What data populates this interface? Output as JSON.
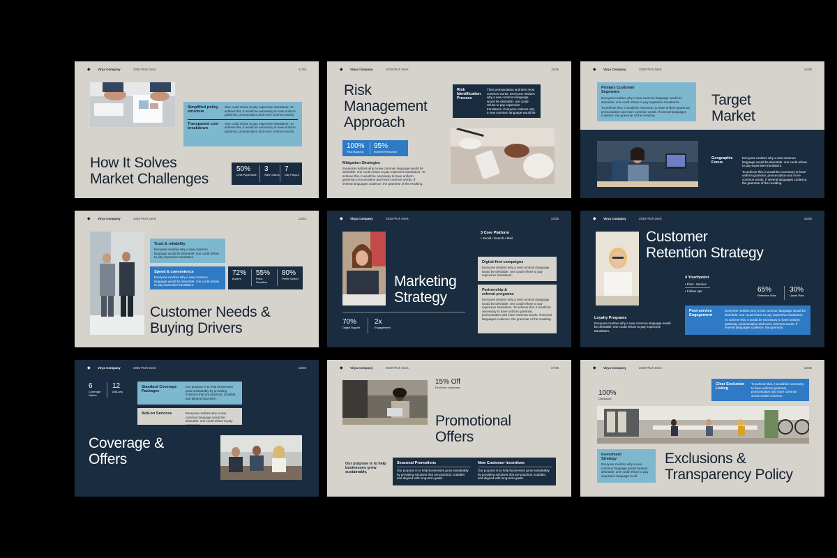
{
  "common": {
    "company": "Virya Company",
    "deck": "2030 Pitch Deck"
  },
  "s1": {
    "page": "11/35",
    "title_line1": "How It Solves",
    "title_line2": "Market Challenges",
    "row1_key": "Simplified policy structure",
    "row1_text": "One could refuse to pay expensive translators. To achieve this, it would be necessary to have uniform grammar, pronunciation and more common words.",
    "row2_key": "Transparent cost breakdown",
    "row2_text": "One could refuse to pay expensive translators. To achieve this, it would be necessary to have uniform grammar, pronunciation and more common words.",
    "stat1_num": "50%",
    "stat1_label": "Less Paperwork",
    "stat2_num": "3",
    "stat2_label": "Step Claims",
    "stat3_num": "7",
    "stat3_label": "Day Payout"
  },
  "s2": {
    "page": "11/35",
    "title_line1": "Risk",
    "title_line2": "Management",
    "title_line3": "Approach",
    "box_key": "Risk Identification Process",
    "box_text": "Their pronunciation and their most common words. Everyone realizes why a new common language would be desirable: one could refuse to pay expensive translators. Everyone realizes why a new common language would be.",
    "stat1_num": "100%",
    "stat1_label": "Risk Mapping",
    "stat2_num": "95%",
    "stat2_label": "Incident Reduction",
    "mit_title": "Mitigation Strategies",
    "mit_text": "Everyone realizes why a new common language would be desirable: one could refuse to pay expensive translators. To achieve this, it would be necessary to have uniform grammar, pronunciation and more common words. If several languages coalesce, the grammar of the resulting."
  },
  "s3": {
    "page": "12/35",
    "title_line1": "Target",
    "title_line2": "Market",
    "box_title": "Primary Customer Segments",
    "box_text1": "Everyone realizes why a new common language would be desirable: one could refuse to pay expensive translators.",
    "box_text2": "To achieve this, it would be necessary to have uniform grammar, pronunciation and more common words. If several languages coalesce, the grammar of the resulting.",
    "geo_key": "Geographic Focus",
    "geo_text1": "Everyone realizes why a new common language would be desirable: one could refuse to pay expensive translators.",
    "geo_text2": "To achieve this, it would be necessary to have uniform grammar, pronunciation and more common words. If several languages coalesce, the grammar of the resulting."
  },
  "s4": {
    "page": "13/35",
    "title_line1": "Customer Needs &",
    "title_line2": "Buying Drivers",
    "box1_title": "Trust & reliability",
    "box1_text": "Everyone realizes why a new common language would be desirable: one could refuse to pay expensive translators.",
    "box2_title": "Speed & convenience",
    "box2_text": "Everyone realizes why a new common language would be desirable: one could refuse to pay expensive translators.",
    "stat1_num": "72%",
    "stat1_label": "Buyers",
    "stat2_num": "55%",
    "stat2_label": "Price-Sensitive",
    "stat3_num": "80%",
    "stat3_label": "Prefer Speed"
  },
  "s5": {
    "page": "14/35",
    "title_line1": "Marketing",
    "title_line2": "Strategy",
    "platform_title": "3 Core Platform",
    "platform_text": "• Social • Search • Mail",
    "box1_title": "Digital-first campaigns",
    "box1_text": "Everyone realizes why a new common language would be desirable: one could refuse to pay expensive translators.",
    "box2_title": "Partnership & referral programs",
    "box2_text": "Everyone realizes why a new common language would be desirable: one could refuse to pay expensive translators. To achieve this, it would be necessary to have uniform grammar, pronunciation and more common words. If several languages coalesce, the grammar of the resulting.",
    "stat1_num": "70%",
    "stat1_label": "Digital Bugdet",
    "stat2_num": "2x",
    "stat2_label": "Engagement"
  },
  "s6": {
    "page": "15/35",
    "title_line1": "Customer",
    "title_line2": "Retention Strategy",
    "tp_title": "4 Youchpoint",
    "tp_item1": "• Post - Service",
    "tp_item2": "• Follow ups",
    "stat1_num": "65%",
    "stat1_label": "Retention Rate",
    "stat2_num": "30%",
    "stat2_label": "Upsell Rate",
    "loyal_title": "Loyalty Programs",
    "loyal_text": "Everyone realizes why a new common language would be desirable: one could refuse to pay expensive translators.",
    "box_key": "Post-service Engagement",
    "box_text1": "Everyone realizes why a new common language would be desirable: one could refuse to pay expensive translators.",
    "box_text2": "To achieve this, it would be necessary to have uniform grammar, pronunciation and more common words. If several languages coalesce, the grammar."
  },
  "s7": {
    "page": "16/35",
    "stat1_num": "6",
    "stat1_label": "Coverage Option",
    "stat2_num": "12",
    "stat2_label": "Add-ons",
    "box1_key": "Standard Coverage Packages",
    "box1_text": "Our purpose is to help businesses grow sustainably by providing solutions that are practical, scalable, and aligned long-term.",
    "box2_key": "Add-on Services",
    "box2_text": "Everyone realizes why a new common language would be desirable: one could refuse to pay expensive.",
    "title_line1": "Coverage &",
    "title_line2": "Offers"
  },
  "s8": {
    "page": "17/35",
    "offer_num": "15% Off",
    "offer_label": "First-time customers",
    "title_line1": "Promotional",
    "title_line2": "Offers",
    "purpose": "Our purpose is to help businesses grow sustainably.",
    "col1_title": "Seasonal Promotions",
    "col1_text": "Our purpose is to help businesses grow sustainably by providing solutions that are practical, scalable, and aligned with long-term goals.",
    "col2_title": "New Customer Incentives",
    "col2_text": "Our purpose is to help businesses grow sustainably by providing solutions that are practical, scalable, and aligned with long-term goals."
  },
  "s9": {
    "page": "18/35",
    "stat_num": "100%",
    "stat_label": "Disclosure",
    "box_key": "Clear Exclusion Listing",
    "box_text": "To achieve this, it would be necessary to have uniform grammar, pronunciation and more common words ended common.",
    "inv_title": "Investment Strategy",
    "inv_text": "Everyone realizes why a new common language would bexerer desirable: one could refuse to pay expensive language to all.",
    "title_line1": "Exclusions &",
    "title_line2": "Transparency Policy"
  }
}
